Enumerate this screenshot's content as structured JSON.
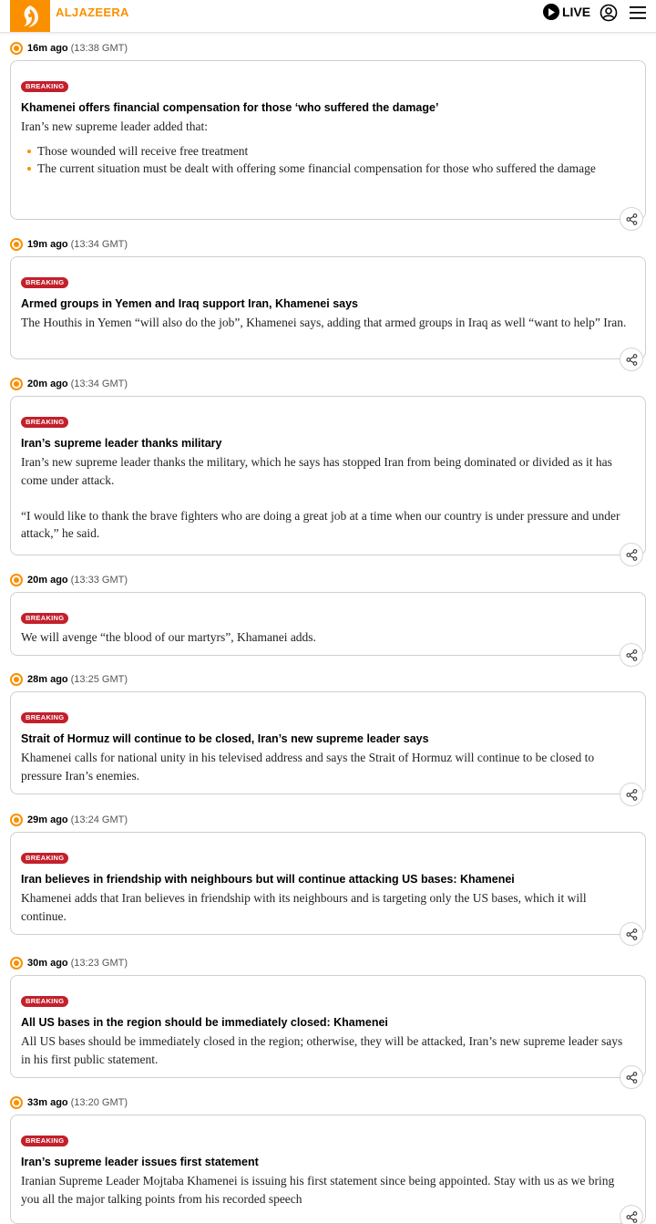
{
  "header": {
    "logo_text": "ALJAZEERA",
    "live_label": "LIVE",
    "brand_color": "#fa9000"
  },
  "posts": [
    {
      "ago": "16m ago",
      "gmt": "(13:38 GMT)",
      "badge": "BREAKING",
      "headline": "Khamenei offers financial compensation for those ‘who suffered the damage’",
      "body": [
        "Iran’s new supreme leader added that:"
      ],
      "bullets": [
        "Those wounded will receive free treatment",
        "The current situation must be dealt with offering some financial compensation for those who suffered the damage"
      ]
    },
    {
      "ago": "19m ago",
      "gmt": "(13:34 GMT)",
      "badge": "BREAKING",
      "headline": "Armed groups in Yemen and Iraq support Iran, Khamenei says",
      "body": [
        "The Houthis in Yemen “will also do the job”, Khamenei says, adding that armed groups in Iraq as well “want to help” Iran."
      ]
    },
    {
      "ago": "20m ago",
      "gmt": "(13:34 GMT)",
      "badge": "BREAKING",
      "headline": "Iran’s supreme leader thanks military",
      "body": [
        "Iran’s new supreme leader thanks the military, which he says has stopped Iran from being dominated or divided as it has come under attack.",
        "“I would like to thank the brave fighters who are doing a great job at a time when our country is under pressure and under attack,” he said."
      ]
    },
    {
      "ago": "20m ago",
      "gmt": "(13:33 GMT)",
      "badge": "BREAKING",
      "headline": "",
      "body": [
        "We will avenge “the blood of our martyrs”, Khamanei adds."
      ]
    },
    {
      "ago": "28m ago",
      "gmt": "(13:25 GMT)",
      "badge": "BREAKING",
      "headline": "Strait of Hormuz will continue to be closed, Iran’s new supreme leader says",
      "body": [
        "Khamenei calls for national unity in his televised address and says the Strait of Hormuz will continue to be closed to pressure Iran’s enemies."
      ]
    },
    {
      "ago": "29m ago",
      "gmt": "(13:24 GMT)",
      "badge": "BREAKING",
      "headline": "Iran believes in friendship with neighbours but will continue attacking US bases: Khamenei",
      "body": [
        "Khamenei adds that Iran believes in friendship with its neighbours and is targeting only the US bases, which it will continue."
      ]
    },
    {
      "ago": "30m ago",
      "gmt": "(13:23 GMT)",
      "badge": "BREAKING",
      "headline": "All US bases in the region should be immediately closed: Khamenei",
      "body": [
        "All US bases should be immediately closed in the region; otherwise, they will be attacked, Iran’s new supreme leader says in his first public statement."
      ]
    },
    {
      "ago": "33m ago",
      "gmt": "(13:20 GMT)",
      "badge": "BREAKING",
      "headline": "Iran’s supreme leader issues first statement",
      "body": [
        "Iranian Supreme Leader Mojtaba Khamenei is issuing his first statement since being appointed. Stay with us as we bring you all the major talking points from his recorded speech"
      ]
    }
  ]
}
